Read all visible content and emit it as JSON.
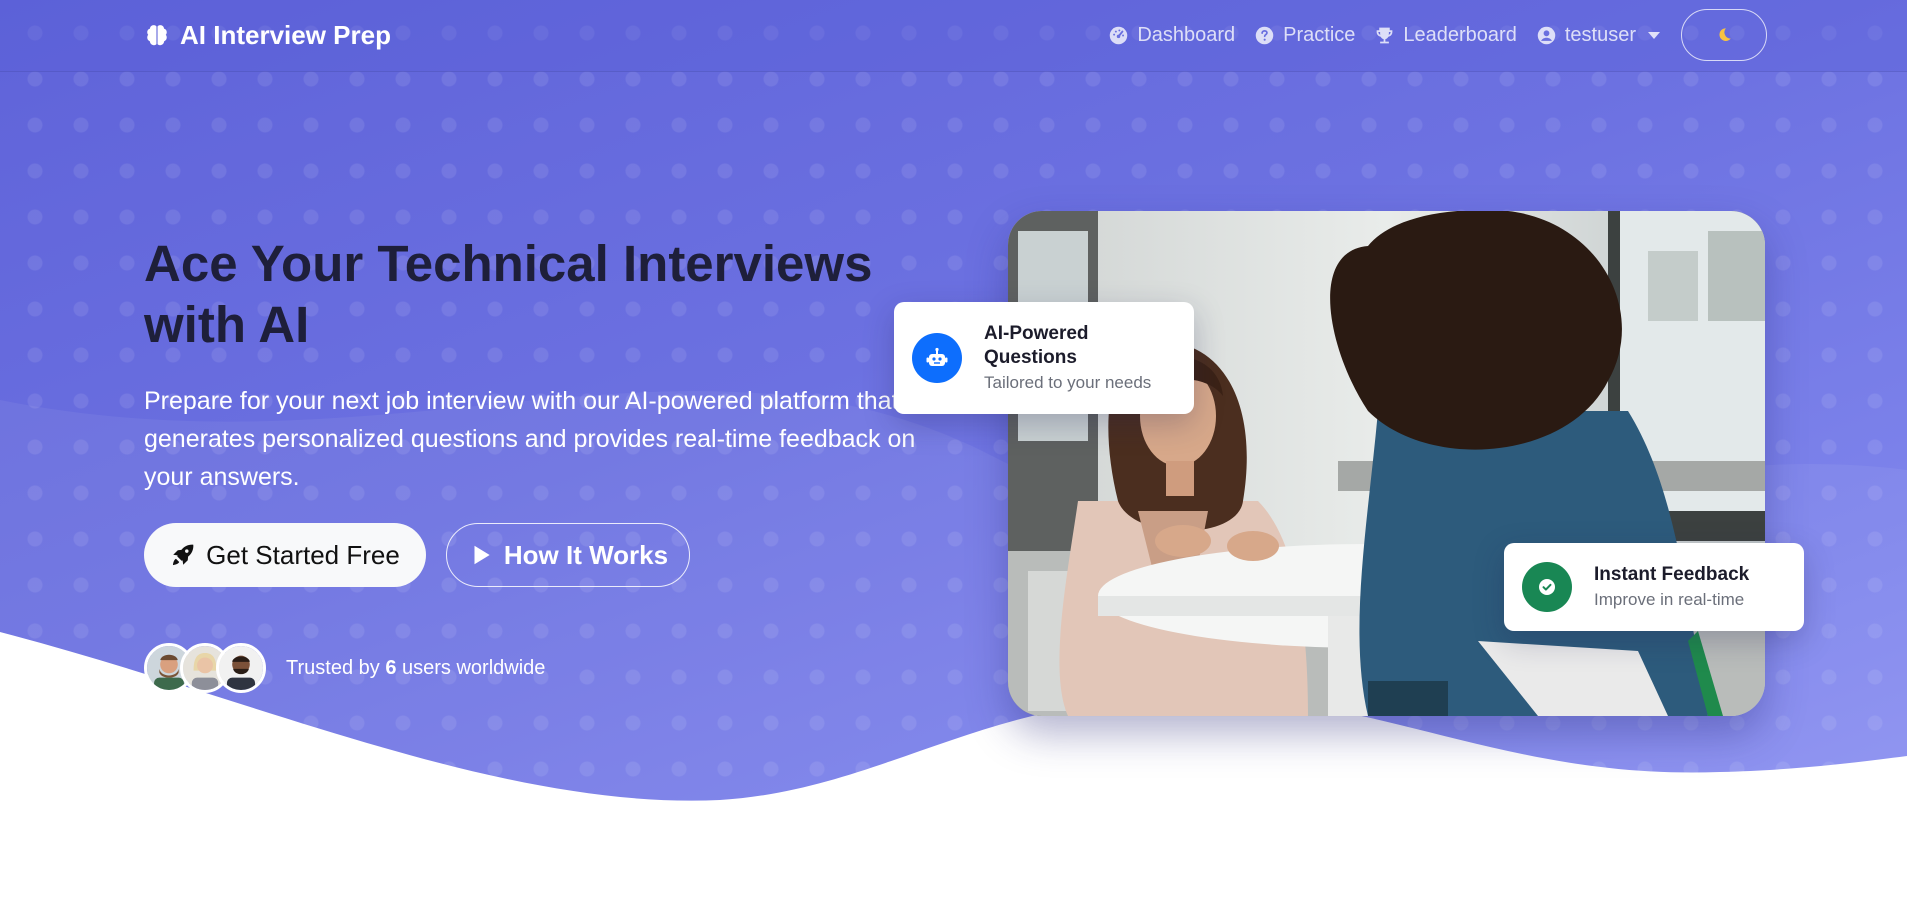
{
  "navbar": {
    "brand": "AI Interview Prep",
    "items": [
      {
        "label": "Dashboard",
        "icon": "gauge-icon"
      },
      {
        "label": "Practice",
        "icon": "question-circle-icon"
      },
      {
        "label": "Leaderboard",
        "icon": "trophy-icon"
      },
      {
        "label": "testuser",
        "icon": "user-circle-icon"
      }
    ],
    "theme_toggle_icon": "moon-icon"
  },
  "hero": {
    "title": "Ace Your Technical Interviews with AI",
    "subtitle": "Prepare for your next job interview with our AI-powered platform that generates personalized questions and provides real-time feedback on your answers.",
    "primary_button": "Get Started Free",
    "secondary_button": "How It Works",
    "trust_prefix": "Trusted by",
    "trust_count": "6",
    "trust_suffix": "users worldwide"
  },
  "cards": {
    "ai": {
      "title": "AI-Powered Questions",
      "subtitle": "Tailored to your needs",
      "icon": "robot-icon",
      "color": "#0d6efd"
    },
    "feedback": {
      "title": "Instant Feedback",
      "subtitle": "Improve in real-time",
      "icon": "check-circle-icon",
      "color": "#198754"
    }
  },
  "colors": {
    "hero_start": "#5f63d9",
    "hero_end": "#8b91f2",
    "title": "#1e1f3a"
  }
}
